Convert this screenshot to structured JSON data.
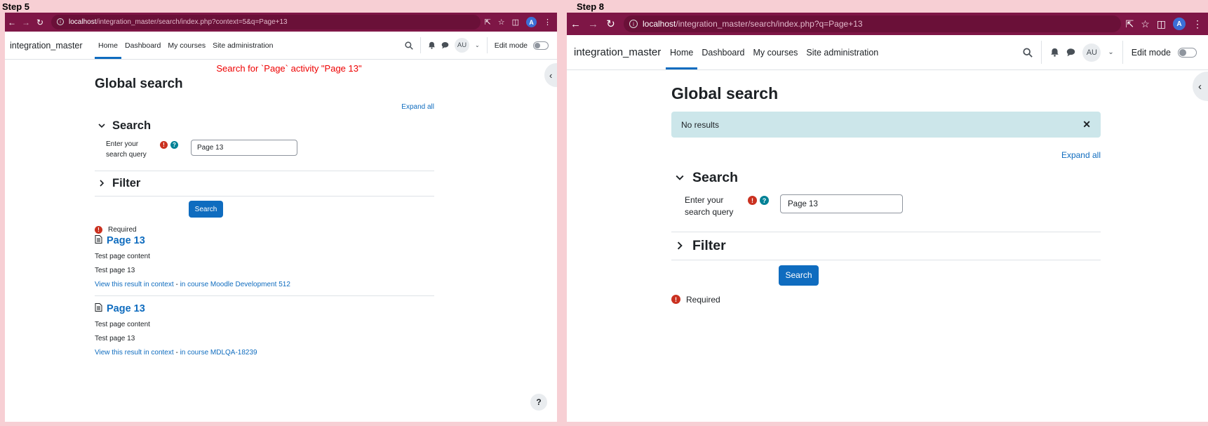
{
  "steps": [
    {
      "label": "Step 5",
      "url_host": "localhost",
      "url_path": "/integration_master/search/index.php?context=5&q=Page+13",
      "annotation": "Search for `Page` activity \"Page 13\"",
      "alert": null,
      "results": [
        {
          "title": "Page 13",
          "content": "Test page content",
          "description": "Test page 13",
          "link": "View this result in context",
          "course": "in course Moodle Development 512"
        },
        {
          "title": "Page 13",
          "content": "Test page content",
          "description": "Test page 13",
          "link": "View this result in context",
          "course": "in course MDLQA-18239"
        }
      ]
    },
    {
      "label": "Step 8",
      "url_host": "localhost",
      "url_path": "/integration_master/search/index.php?q=Page+13",
      "alert": "No results"
    }
  ],
  "browser": {
    "profile_initial": "A"
  },
  "site": {
    "brand": "integration_master",
    "nav": [
      "Home",
      "Dashboard",
      "My courses",
      "Site administration"
    ],
    "user_initials": "AU",
    "edit_mode": "Edit mode"
  },
  "page": {
    "title": "Global search",
    "expand_all": "Expand all",
    "search_section": "Search",
    "query_label": "Enter your search query",
    "query_value": "Page 13",
    "filter_section": "Filter",
    "search_button": "Search",
    "required": "Required",
    "dash": "-"
  },
  "icons": {
    "back": "arrow-left-icon",
    "forward": "arrow-right-icon",
    "reload": "reload-icon",
    "share": "share-icon",
    "star": "star-icon",
    "sidepanel": "side-panel-icon",
    "menu": "kebab-menu-icon",
    "search": "search-icon",
    "bell": "bell-icon",
    "chat": "chat-icon",
    "page": "page-document-icon",
    "required": "required-exclamation-icon",
    "help": "help-question-icon"
  }
}
